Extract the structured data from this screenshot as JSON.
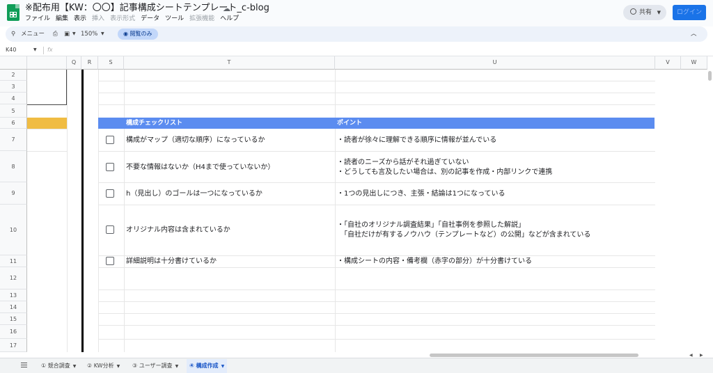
{
  "doc": {
    "title": "※配布用【KW：〇〇】記事構成シートテンプレート_c-blog",
    "cloud_icon": "cloud-done-icon",
    "menus": [
      "ファイル",
      "編集",
      "表示",
      "挿入",
      "表示形式",
      "データ",
      "ツール",
      "拡張機能",
      "ヘルプ"
    ],
    "share_label": "共有",
    "login_label": "ログイン"
  },
  "toolbar": {
    "menu_label": "メニュー",
    "zoom": "150%",
    "view_only": "閲覧のみ"
  },
  "formula": {
    "cell_ref": "K40",
    "fx": "fx"
  },
  "columns": [
    "Q",
    "R",
    "S",
    "T",
    "U",
    "V",
    "W"
  ],
  "rows": [
    "2",
    "3",
    "4",
    "5",
    "6",
    "7",
    "8",
    "9",
    "10",
    "11",
    "12",
    "13",
    "14",
    "15",
    "16",
    "17"
  ],
  "checklist": {
    "header_left": "構成チェックリスト",
    "header_right": "ポイント",
    "items": [
      {
        "check": "構成がマップ（適切な順序）になっているか",
        "point": [
          "・読者が徐々に理解できる順序に情報が並んでいる"
        ]
      },
      {
        "check": "不要な情報はないか（H4まで使っていないか）",
        "point": [
          "・読者のニーズから話がそれ過ぎていない",
          "・どうしても言及したい場合は、別の記事を作成・内部リンクで連携"
        ]
      },
      {
        "check": "h（見出し）のゴールは一つになっているか",
        "point": [
          "・1つの見出しにつき、主張・結論は1つになっている"
        ]
      },
      {
        "check": "オリジナル内容は含まれているか",
        "point": [
          "・「自社のオリジナル調査結果」「自社事例を参照した解説」",
          "　「自社だけが有するノウハウ（テンプレートなど）の公開」などが含まれている"
        ]
      },
      {
        "check": "詳細説明は十分書けているか",
        "point": [
          "・構成シートの内容・備考欄（赤字の部分）が十分書けている"
        ]
      }
    ]
  },
  "tabs": [
    {
      "label": "① 競合調査",
      "active": false
    },
    {
      "label": "② KW分析",
      "active": false
    },
    {
      "label": "③ ユーザー調査",
      "active": false
    },
    {
      "label": "④ 構成作成",
      "active": true
    }
  ],
  "colors": {
    "accent": "#5b8cf0",
    "highlight": "#f0bc43",
    "login": "#1a73e8"
  }
}
